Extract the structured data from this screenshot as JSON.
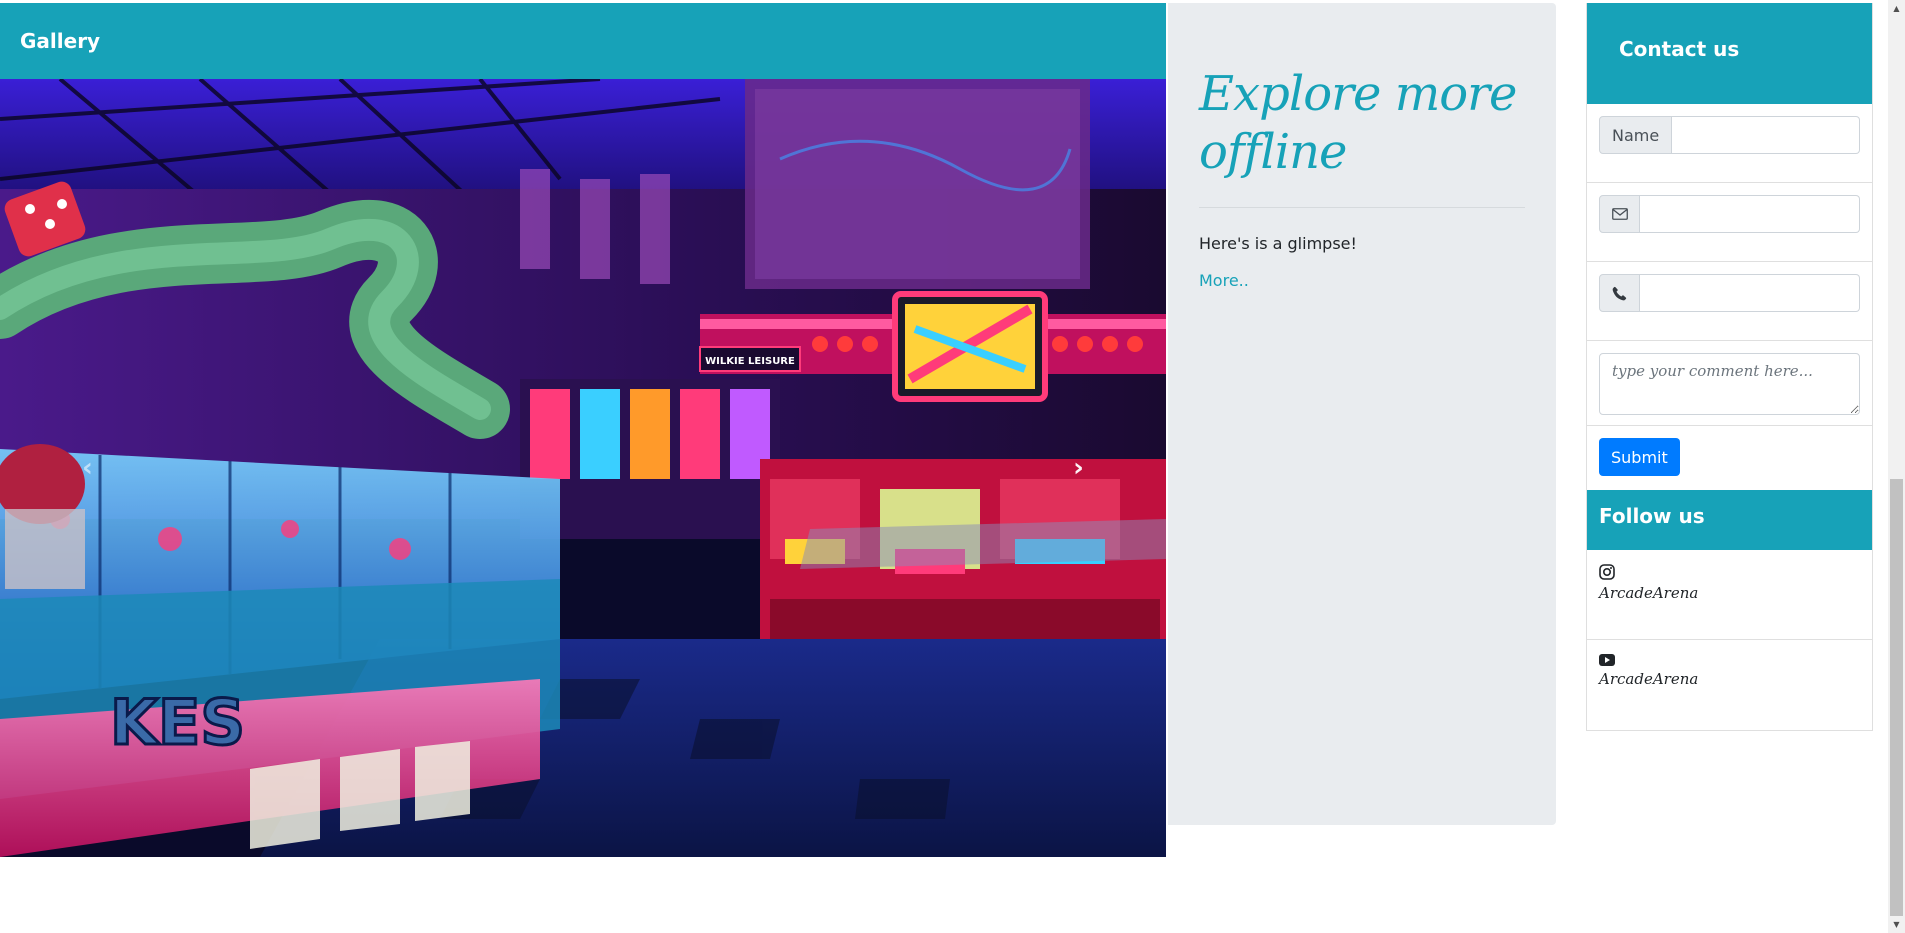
{
  "gallery": {
    "title": "Gallery",
    "prev_glyph": "‹",
    "next_glyph": "›",
    "prev_icon": "chevron-left-icon",
    "next_icon": "chevron-right-icon",
    "image": "arcade-interior-photo",
    "sign_text": "WILKIE LEISURE"
  },
  "jumbotron": {
    "heading": "Explore more offline",
    "text": "Here's is a glimpse!",
    "link": "More.."
  },
  "contact": {
    "title": "Contact us",
    "name_label": "Name",
    "email_icon": "envelope-icon",
    "phone_icon": "phone-icon",
    "comment_placeholder": "type your comment here...",
    "submit_label": "Submit"
  },
  "follow": {
    "title": "Follow us",
    "items": [
      {
        "icon": "instagram-icon",
        "handle": "ArcadeArena"
      },
      {
        "icon": "youtube-icon",
        "handle": "ArcadeArena"
      }
    ]
  },
  "colors": {
    "accent": "#17a2b8",
    "primary": "#007bff",
    "jumbotron_bg": "#e9ecef"
  },
  "scrollbar": {
    "up": "▲",
    "down": "▼"
  }
}
